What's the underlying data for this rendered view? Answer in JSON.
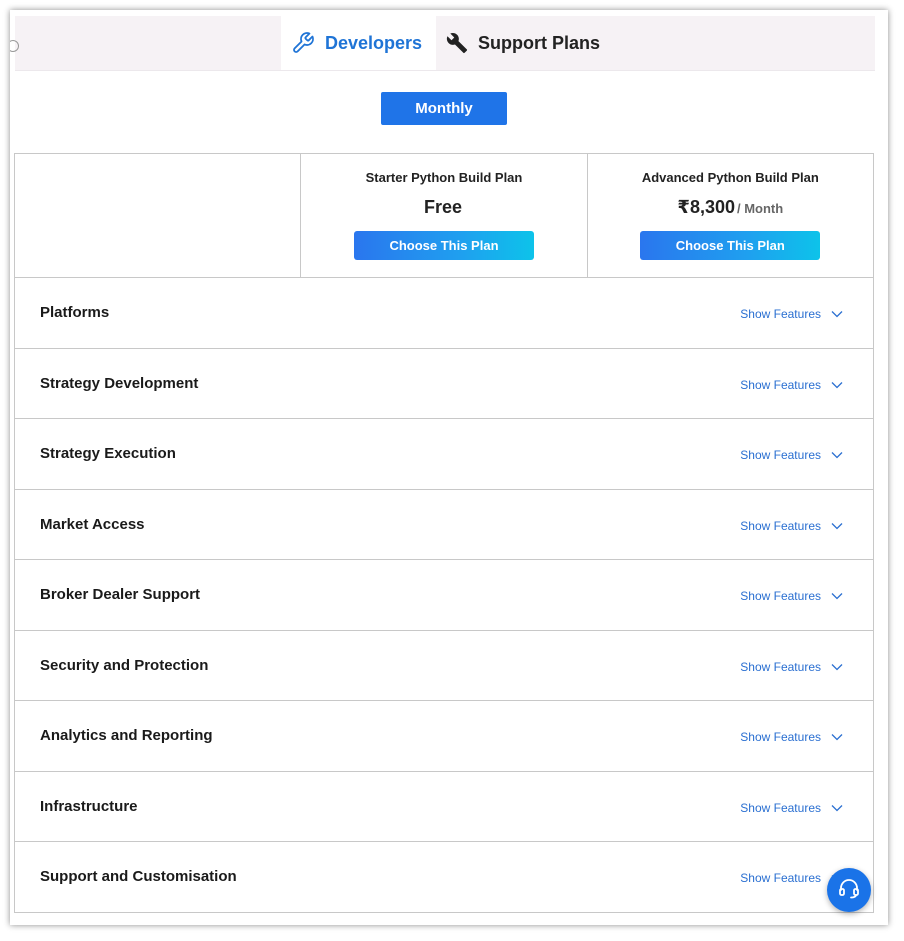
{
  "tabs": {
    "developers_label": "Developers",
    "support_label": "Support Plans"
  },
  "billing": {
    "monthly_label": "Monthly"
  },
  "plans": [
    {
      "name": "Starter Python Build Plan",
      "price": "Free",
      "period": "",
      "button_label": "Choose This Plan"
    },
    {
      "name": "Advanced Python Build Plan",
      "price": "₹8,300",
      "period": "/ Month",
      "button_label": "Choose This Plan"
    }
  ],
  "feature_rows": [
    {
      "title": "Platforms",
      "action": "Show Features"
    },
    {
      "title": "Strategy Development",
      "action": "Show Features"
    },
    {
      "title": "Strategy Execution",
      "action": "Show Features"
    },
    {
      "title": "Market Access",
      "action": "Show Features"
    },
    {
      "title": "Broker Dealer Support",
      "action": "Show Features"
    },
    {
      "title": "Security and Protection",
      "action": "Show Features"
    },
    {
      "title": "Analytics and Reporting",
      "action": "Show Features"
    },
    {
      "title": "Infrastructure",
      "action": "Show Features"
    },
    {
      "title": "Support and Customisation",
      "action": "Show Features"
    }
  ],
  "colors": {
    "accent": "#1f74e8",
    "link": "#2a6fd1",
    "tabbar_bg": "#f6f2f5",
    "border": "#c8c8c8"
  },
  "icons": {
    "developers_tab": "wrench-icon",
    "support_tab": "wrench-icon",
    "row_toggle": "chevron-down-icon",
    "support_bubble": "headset-icon"
  }
}
